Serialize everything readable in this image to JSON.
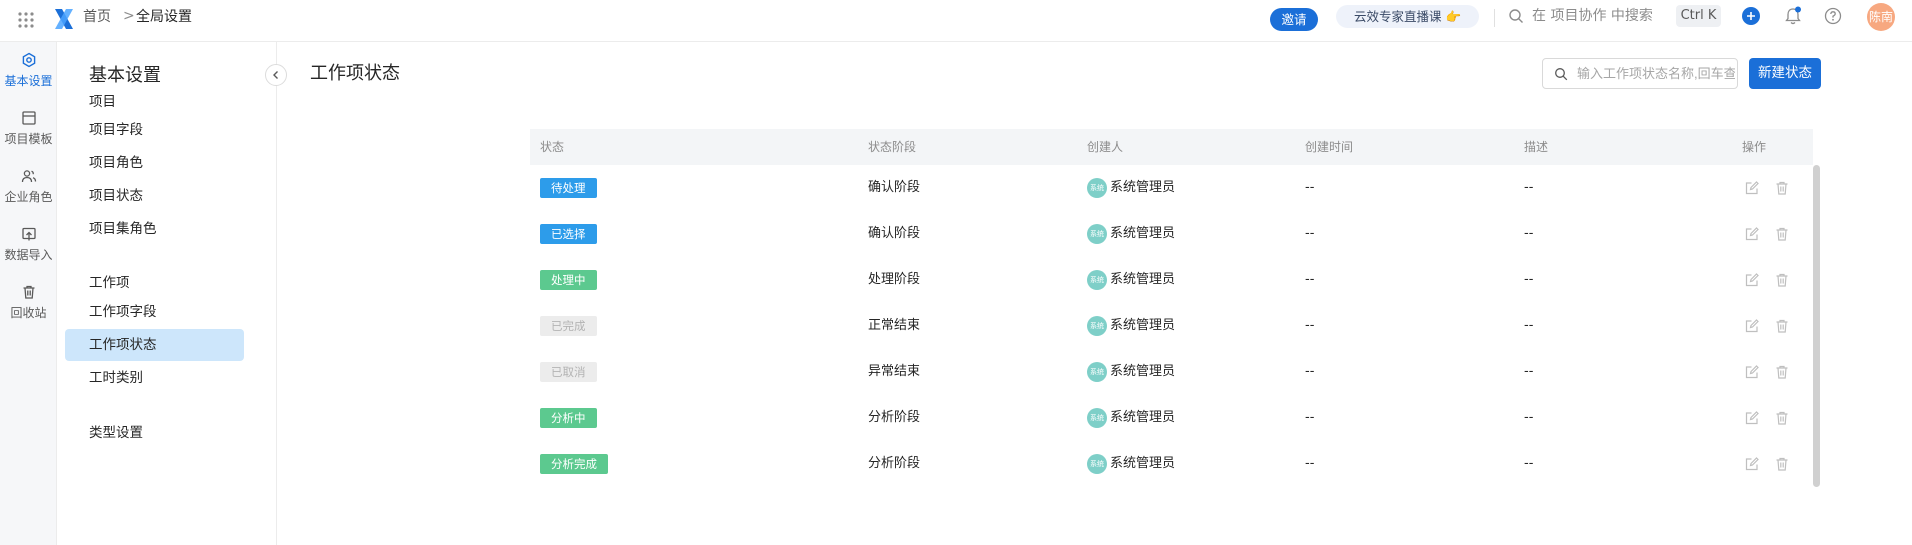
{
  "topbar": {
    "breadcrumb": [
      "首页",
      "全局设置"
    ],
    "breadcrumb_sep": ">",
    "invite_label": "邀请",
    "live_label": "云效专家直播课 👉",
    "search_placeholder": "在 项目协作 中搜索",
    "shortcut": "Ctrl K",
    "avatar_text": "陈南"
  },
  "rail": [
    {
      "label": "基本设置",
      "icon": "settings-hexagon-icon",
      "active": true
    },
    {
      "label": "项目模板",
      "icon": "template-icon"
    },
    {
      "label": "企业角色",
      "icon": "users-icon"
    },
    {
      "label": "数据导入",
      "icon": "import-icon"
    },
    {
      "label": "回收站",
      "icon": "trash-icon"
    }
  ],
  "sidenav": {
    "title": "基本设置",
    "groups": [
      {
        "title": "项目",
        "items": [
          "项目字段",
          "项目角色",
          "项目状态",
          "项目集角色"
        ]
      },
      {
        "title": "工作项",
        "items": [
          "工作项字段",
          "工作项状态",
          "工时类别"
        ]
      },
      {
        "title": "类型设置",
        "items": []
      }
    ],
    "active_item": "工作项状态"
  },
  "main": {
    "title": "工作项状态",
    "search_placeholder": "输入工作项状态名称,回车查询",
    "new_button": "新建状态",
    "columns": [
      "状态",
      "状态阶段",
      "创建人",
      "创建时间",
      "描述",
      "操作"
    ],
    "rows": [
      {
        "status": "待处理",
        "status_color": "#2d9cea",
        "stage": "确认阶段",
        "creator": "系统管理员",
        "avatar_text": "系统",
        "created": "--",
        "desc": "--"
      },
      {
        "status": "已选择",
        "status_color": "#2d9cea",
        "stage": "确认阶段",
        "creator": "系统管理员",
        "avatar_text": "系统",
        "created": "--",
        "desc": "--"
      },
      {
        "status": "处理中",
        "status_color": "#5cc98f",
        "stage": "处理阶段",
        "creator": "系统管理员",
        "avatar_text": "系统",
        "created": "--",
        "desc": "--"
      },
      {
        "status": "已完成",
        "status_color": "#ececec",
        "status_text_color": "#b3b3b3",
        "stage": "正常结束",
        "creator": "系统管理员",
        "avatar_text": "系统",
        "created": "--",
        "desc": "--"
      },
      {
        "status": "已取消",
        "status_color": "#ececec",
        "status_text_color": "#b3b3b3",
        "stage": "异常结束",
        "creator": "系统管理员",
        "avatar_text": "系统",
        "created": "--",
        "desc": "--"
      },
      {
        "status": "分析中",
        "status_color": "#5cc98f",
        "stage": "分析阶段",
        "creator": "系统管理员",
        "avatar_text": "系统",
        "created": "--",
        "desc": "--"
      },
      {
        "status": "分析完成",
        "status_color": "#5cc98f",
        "stage": "分析阶段",
        "creator": "系统管理员",
        "avatar_text": "系统",
        "created": "--",
        "desc": "--"
      }
    ]
  },
  "colors": {
    "accent": "#1b6fd8",
    "active_nav_bg": "#cde6fb"
  }
}
